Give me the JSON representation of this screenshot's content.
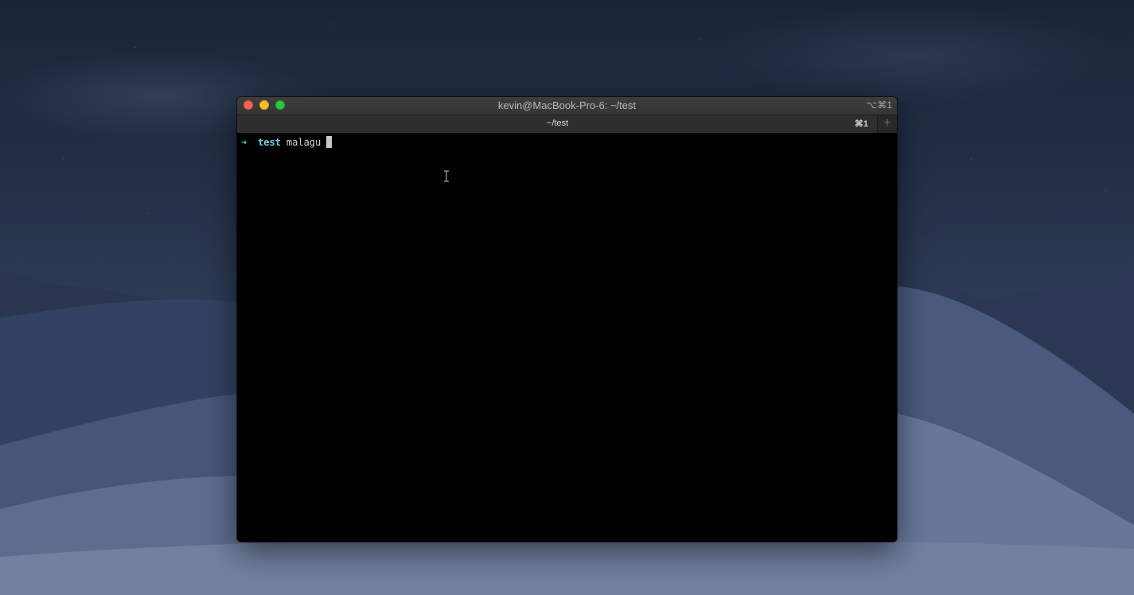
{
  "window": {
    "title": "kevin@MacBook-Pro-6: ~/test",
    "title_shortcut": "⌥⌘1"
  },
  "tab": {
    "label": "~/test",
    "shortcut": "⌘1",
    "new_tab_icon": "plus-icon"
  },
  "terminal": {
    "prompt_arrow": "➜",
    "prompt_dir": "test",
    "command": "malagu"
  },
  "colors": {
    "prompt_arrow": "#4ee067",
    "prompt_dir": "#5ed8e8",
    "close": "#fc5f57",
    "minimize": "#fdbc2e",
    "maximize": "#28c840"
  }
}
